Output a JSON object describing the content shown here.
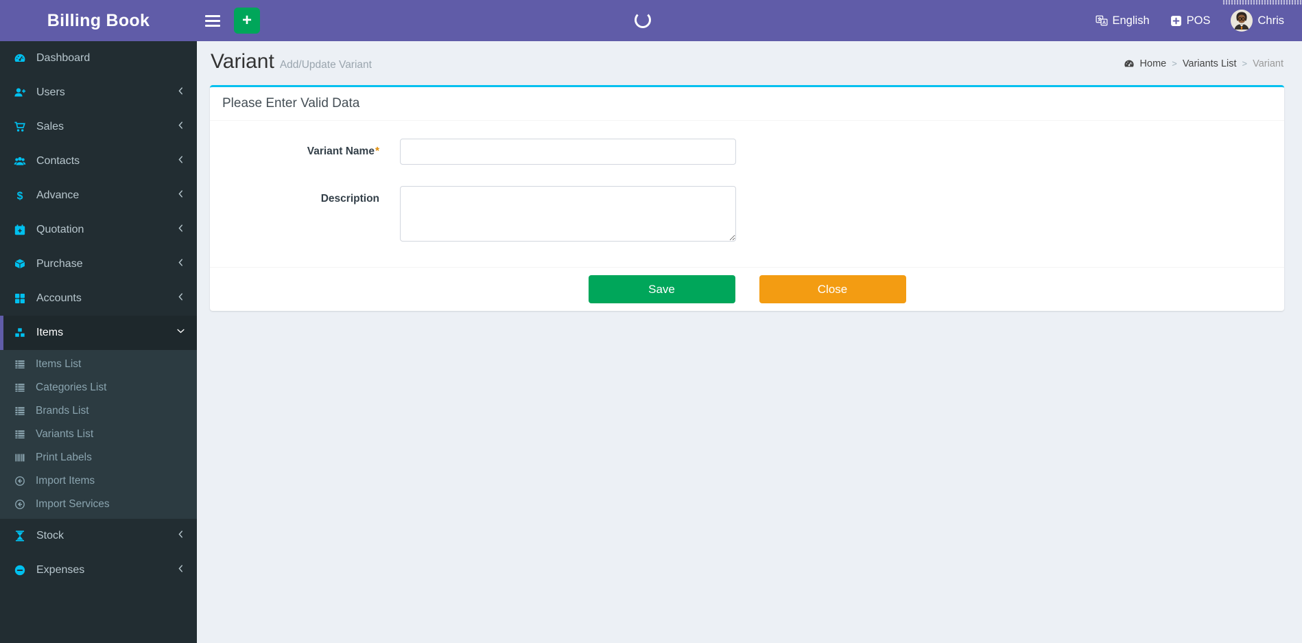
{
  "app": {
    "title": "Billing Book"
  },
  "header": {
    "language_label": "English",
    "pos_label": "POS",
    "user_name": "Chris",
    "language_icon": "language-icon",
    "pos_icon": "plus-square-icon",
    "avatar_icon": "user-avatar"
  },
  "sidebar": {
    "items": [
      {
        "label": "Dashboard",
        "icon": "speedometer-icon"
      },
      {
        "label": "Users",
        "icon": "user-plus-icon",
        "chevron": "left"
      },
      {
        "label": "Sales",
        "icon": "cart-icon",
        "chevron": "left"
      },
      {
        "label": "Contacts",
        "icon": "users-icon",
        "chevron": "left"
      },
      {
        "label": "Advance",
        "icon": "dollar-icon",
        "chevron": "left"
      },
      {
        "label": "Quotation",
        "icon": "calendar-plus-icon",
        "chevron": "left"
      },
      {
        "label": "Purchase",
        "icon": "cube-icon",
        "chevron": "left"
      },
      {
        "label": "Accounts",
        "icon": "grid-icon",
        "chevron": "left"
      },
      {
        "label": "Items",
        "icon": "cubes-icon",
        "chevron": "down",
        "active": true,
        "submenu": [
          {
            "label": "Items List",
            "icon": "list-icon"
          },
          {
            "label": "Categories List",
            "icon": "list-icon"
          },
          {
            "label": "Brands List",
            "icon": "list-icon"
          },
          {
            "label": "Variants List",
            "icon": "list-icon"
          },
          {
            "label": "Print Labels",
            "icon": "barcode-icon"
          },
          {
            "label": "Import Items",
            "icon": "import-icon"
          },
          {
            "label": "Import Services",
            "icon": "import-icon"
          }
        ]
      },
      {
        "label": "Stock",
        "icon": "hourglass-icon",
        "chevron": "left"
      },
      {
        "label": "Expenses",
        "icon": "minus-circle-icon",
        "chevron": "left"
      }
    ]
  },
  "page": {
    "title": "Variant",
    "subtitle": "Add/Update Variant",
    "breadcrumb": {
      "home_icon": "speedometer-icon",
      "separator": ">",
      "items": [
        {
          "label": "Home",
          "current": false
        },
        {
          "label": "Variants List",
          "current": false
        },
        {
          "label": "Variant",
          "current": true
        }
      ]
    }
  },
  "form": {
    "title": "Please Enter Valid Data",
    "required_marker": "*",
    "fields": [
      {
        "label": "Variant Name",
        "required": true,
        "value": "",
        "placeholder": ""
      },
      {
        "label": "Description",
        "required": false,
        "value": "",
        "placeholder": ""
      }
    ],
    "save_label": "Save",
    "close_label": "Close"
  },
  "colors": {
    "header_purple": "#605ca8",
    "sidebar_bg": "#222d32",
    "submenu_bg": "#2c3b41",
    "active_item_bg": "#1e282c",
    "icon_cyan": "#00c0ef",
    "save_green": "#00a65a",
    "close_orange": "#f39c12",
    "content_bg": "#ecf0f5",
    "card_top_border": "#00c0ef",
    "required_asterisk": "#e08e0b"
  }
}
